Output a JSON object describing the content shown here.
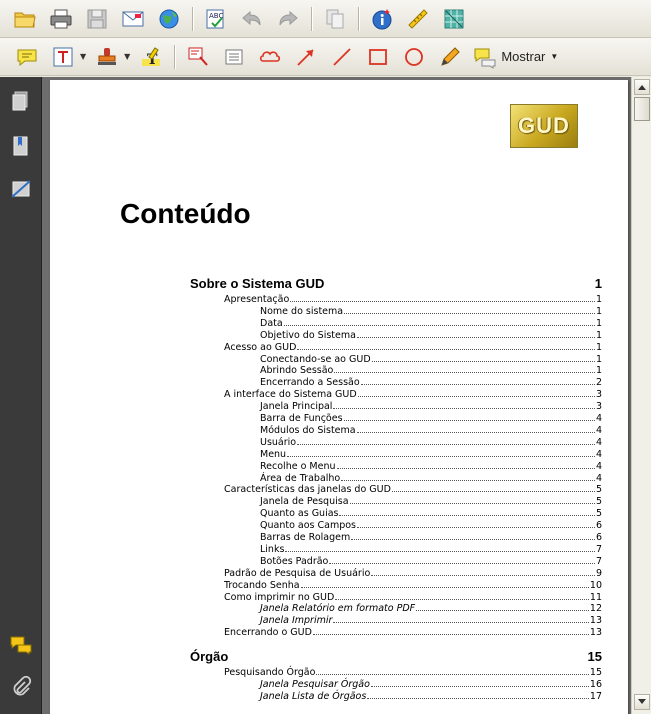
{
  "toolbar2": {
    "mostrar_label": "Mostrar"
  },
  "document": {
    "logo_text": "GUD",
    "title": "Conteúdo",
    "toc": [
      {
        "label": "Sobre o Sistema GUD",
        "page": "1",
        "level": 0
      },
      {
        "label": "Apresentação",
        "page": "1",
        "level": 1
      },
      {
        "label": "Nome do sistema",
        "page": "1",
        "level": 2
      },
      {
        "label": "Data",
        "page": "1",
        "level": 2
      },
      {
        "label": "Objetivo do Sistema",
        "page": "1",
        "level": 2
      },
      {
        "label": "Acesso ao GUD",
        "page": "1",
        "level": 1
      },
      {
        "label": "Conectando-se ao GUD",
        "page": "1",
        "level": 2
      },
      {
        "label": "Abrindo Sessão",
        "page": "1",
        "level": 2
      },
      {
        "label": "Encerrando a Sessão",
        "page": "2",
        "level": 2
      },
      {
        "label": "A interface do Sistema GUD",
        "page": "3",
        "level": 1
      },
      {
        "label": "Janela Principal",
        "page": "3",
        "level": 2
      },
      {
        "label": "Barra de Funções",
        "page": "4",
        "level": 2
      },
      {
        "label": "Módulos do Sistema",
        "page": "4",
        "level": 2
      },
      {
        "label": "Usuário",
        "page": "4",
        "level": 2
      },
      {
        "label": "Menu",
        "page": "4",
        "level": 2
      },
      {
        "label": "Recolhe o Menu",
        "page": "4",
        "level": 2
      },
      {
        "label": "Área de Trabalho",
        "page": "4",
        "level": 2
      },
      {
        "label": "Características das janelas do GUD",
        "page": "5",
        "level": 1
      },
      {
        "label": "Janela de Pesquisa",
        "page": "5",
        "level": 2
      },
      {
        "label": "Quanto as Guias",
        "page": "5",
        "level": 2
      },
      {
        "label": "Quanto aos Campos",
        "page": "6",
        "level": 2
      },
      {
        "label": "Barras de Rolagem",
        "page": "6",
        "level": 2
      },
      {
        "label": "Links",
        "page": "7",
        "level": 2
      },
      {
        "label": "Botões Padrão",
        "page": "7",
        "level": 2
      },
      {
        "label": "Padrão de Pesquisa de Usuário",
        "page": "9",
        "level": 1
      },
      {
        "label": "Trocando Senha",
        "page": "10",
        "level": 1
      },
      {
        "label": "Como imprimir no GUD",
        "page": "11",
        "level": 1
      },
      {
        "label": "Janela Relatório em formato PDF",
        "page": "12",
        "level": 2,
        "italic": true
      },
      {
        "label": "Janela Imprimir",
        "page": "13",
        "level": 2,
        "italic": true
      },
      {
        "label": "Encerrando o GUD",
        "page": "13",
        "level": 1
      },
      {
        "label": "Órgão",
        "page": "15",
        "level": 0
      },
      {
        "label": "Pesquisando Órgão",
        "page": "15",
        "level": 1
      },
      {
        "label": "Janela Pesquisar Órgão",
        "page": "16",
        "level": 2,
        "italic": true
      },
      {
        "label": "Janela Lista de Órgãos",
        "page": "17",
        "level": 2,
        "italic": true
      }
    ]
  }
}
